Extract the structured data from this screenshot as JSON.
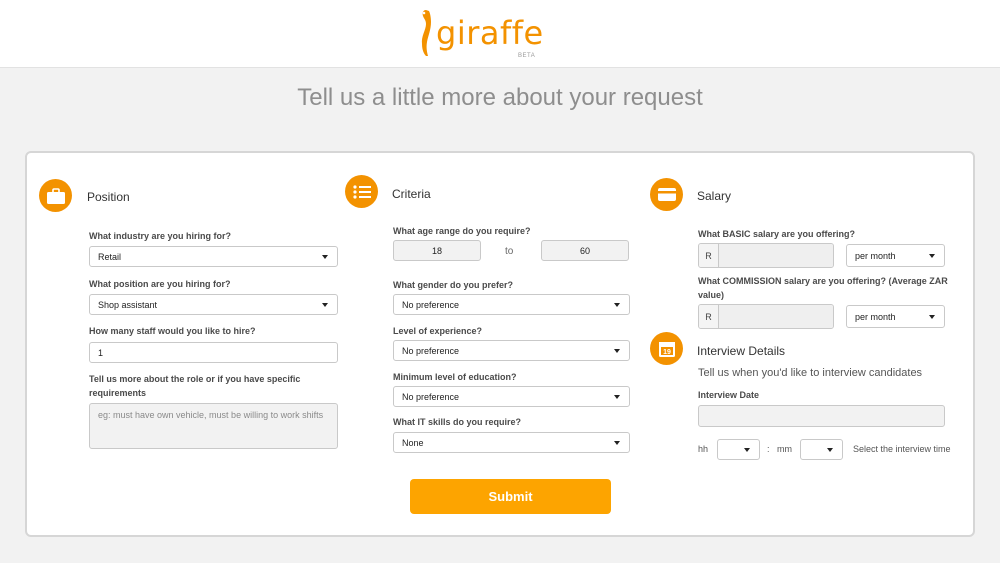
{
  "brand": {
    "name": "giraffe",
    "beta": "BETA"
  },
  "page_title": "Tell us a little more about your request",
  "position": {
    "title": "Position",
    "industry_label": "What industry are you hiring for?",
    "industry_value": "Retail",
    "role_label": "What position are you hiring for?",
    "role_value": "Shop assistant",
    "staff_label": "How many staff would you like to hire?",
    "staff_value": "1",
    "more_label": "Tell us more about the role or if you have specific requirements",
    "more_placeholder": "eg: must have own vehicle, must be willing to work shifts"
  },
  "criteria": {
    "title": "Criteria",
    "age_label": "What age range do you require?",
    "age_from": "18",
    "age_to_text": "to",
    "age_to": "60",
    "gender_label": "What gender do you prefer?",
    "gender_value": "No preference",
    "experience_label": "Level of experience?",
    "experience_value": "No preference",
    "education_label": "Minimum level of education?",
    "education_value": "No preference",
    "it_label": "What IT skills do you require?",
    "it_value": "None"
  },
  "salary": {
    "title": "Salary",
    "basic_label": "What BASIC salary are you offering?",
    "currency": "R",
    "basic_period": "per month",
    "commission_label": "What COMMISSION salary are you offering? (Average ZAR value)",
    "commission_period": "per month"
  },
  "interview": {
    "title": "Interview Details",
    "subtitle": "Tell us when you'd like to interview candidates",
    "date_label": "Interview Date",
    "calendar_day": "19",
    "hh_label": "hh",
    "colon": ":",
    "mm_label": "mm",
    "time_hint": "Select the interview time"
  },
  "submit_label": "Submit",
  "colors": {
    "accent": "#f39200",
    "button": "#fda400"
  }
}
